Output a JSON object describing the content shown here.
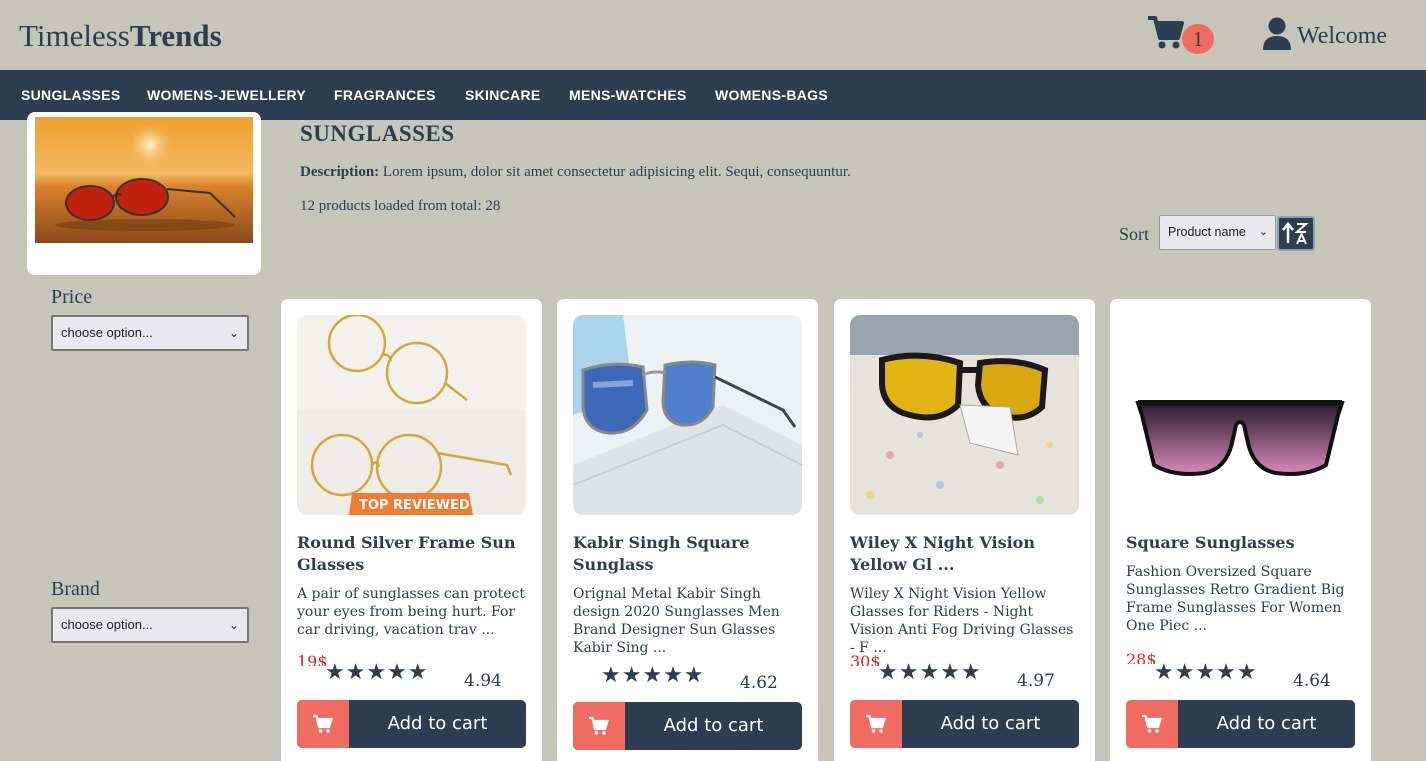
{
  "header": {
    "logo_light": "Timeless",
    "logo_bold": "Trends",
    "cart_count": "1",
    "welcome": "Welcome"
  },
  "nav": {
    "items": [
      "SUNGLASSES",
      "WOMENS-JEWELLERY",
      "FRAGRANCES",
      "SKINCARE",
      "MENS-WATCHES",
      "WOMENS-BAGS"
    ]
  },
  "category": {
    "title": "SUNGLASSES",
    "description_label": "Description:",
    "description": "Lorem ipsum, dolor sit amet consectetur adipisicing elit. Sequi, consequuntur.",
    "loaded_text": "12 products loaded from total: 28"
  },
  "sort": {
    "label": "Sort",
    "selected": "Product name"
  },
  "filters": {
    "price_label": "Price",
    "price_value": "choose option...",
    "brand_label": "Brand",
    "brand_value": "choose option..."
  },
  "products": [
    {
      "name": "Round Silver Frame Sun Glasses",
      "description": "A pair of sunglasses can protect your eyes from being hurt. For car driving, vacation trav ...",
      "price": "19$",
      "stars": "★★★★★",
      "rating": "4.94",
      "button": "Add to cart",
      "badge": "TOP REVIEWED"
    },
    {
      "name": "Kabir Singh Square Sunglass",
      "description": "Orignal Metal Kabir Singh design 2020 Sunglasses Men Brand Designer Sun Glasses Kabir Sing ...",
      "price": "",
      "stars": "★★★★★",
      "rating": "4.62",
      "button": "Add to cart"
    },
    {
      "name": "Wiley X Night Vision Yellow Gl ...",
      "description": "Wiley X Night Vision Yellow Glasses for Riders - Night Vision Anti Fog Driving Glasses - F ...",
      "price": "30$",
      "stars": "★★★★★",
      "rating": "4.97",
      "button": "Add to cart"
    },
    {
      "name": "Square Sunglasses",
      "description": "Fashion Oversized Square Sunglasses Retro Gradient Big Frame Sunglasses For Women One Piec ...",
      "price": "28$",
      "stars": "★★★★★",
      "rating": "4.64",
      "button": "Add to cart"
    }
  ],
  "colors": {
    "background": "#c5c5b9",
    "primary": "#2c3e50",
    "accent": "#f06b62",
    "price": "#e02020"
  }
}
